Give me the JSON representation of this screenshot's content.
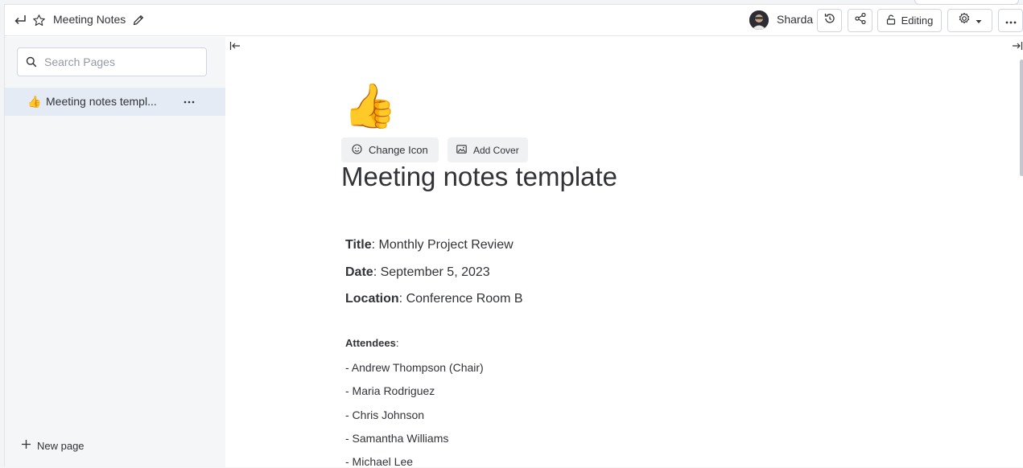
{
  "topbar": {
    "title": "Meeting Notes",
    "user_name": "Sharda",
    "editing_label": "Editing",
    "icons": [
      "back-arrow-icon",
      "star-icon",
      "pencil-icon",
      "history-icon",
      "share-icon",
      "settings-icon",
      "more-icon"
    ]
  },
  "sidebar": {
    "search_placeholder": "Search Pages",
    "pages": [
      {
        "emoji": "👍",
        "label": "Meeting notes templ..."
      }
    ],
    "new_page_label": "New page"
  },
  "main": {
    "page_emoji": "👍",
    "change_icon_label": "Change Icon",
    "add_cover_label": "Add Cover",
    "title": "Meeting notes template",
    "fields": [
      {
        "key": "Title",
        "value": ": Monthly Project Review"
      },
      {
        "key": "Date",
        "value": ": September 5, 2023"
      },
      {
        "key": "Location",
        "value": ": Conference Room B"
      }
    ],
    "attendees_label": "Attendees",
    "attendees_colon": ":",
    "attendees": [
      "- Andrew Thompson (Chair)",
      "- Maria Rodriguez",
      "- Chris Johnson",
      "- Samantha Williams",
      "- Michael Lee"
    ]
  }
}
